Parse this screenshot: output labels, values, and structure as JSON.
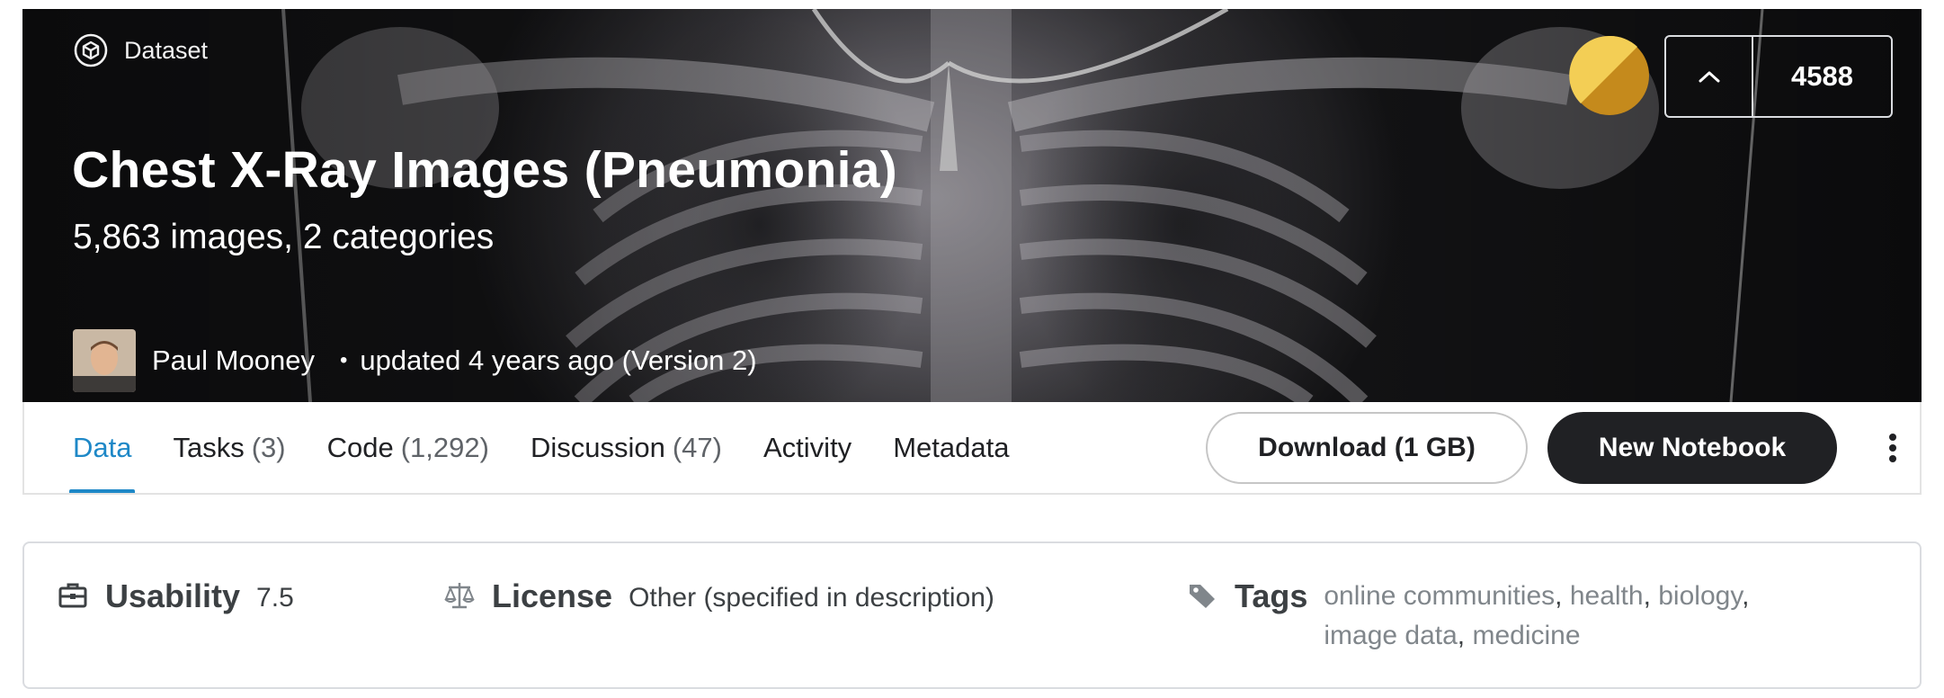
{
  "header": {
    "type_label": "Dataset",
    "title": "Chest X-Ray Images (Pneumonia)",
    "subtitle": "5,863 images, 2 categories",
    "author": "Paul Mooney",
    "updated": "updated 4 years ago (Version 2)",
    "vote_count": "4588",
    "medal": "gold-medal-icon"
  },
  "tabs": [
    {
      "label": "Data",
      "count": ""
    },
    {
      "label": "Tasks",
      "count": "(3)"
    },
    {
      "label": "Code",
      "count": "(1,292)"
    },
    {
      "label": "Discussion",
      "count": "(47)"
    },
    {
      "label": "Activity",
      "count": ""
    },
    {
      "label": "Metadata",
      "count": ""
    }
  ],
  "active_tab": "Data",
  "actions": {
    "download": "Download (1 GB)",
    "new_notebook": "New Notebook"
  },
  "info": {
    "usability_label": "Usability",
    "usability_value": "7.5",
    "license_label": "License",
    "license_value": "Other (specified in description)",
    "tags_label": "Tags",
    "tags": [
      "online communities",
      "health",
      "biology",
      "image data",
      "medicine"
    ]
  },
  "colors": {
    "accent": "#1e88c7",
    "button_dark": "#202124",
    "medal_gold": "#e9b92b"
  }
}
